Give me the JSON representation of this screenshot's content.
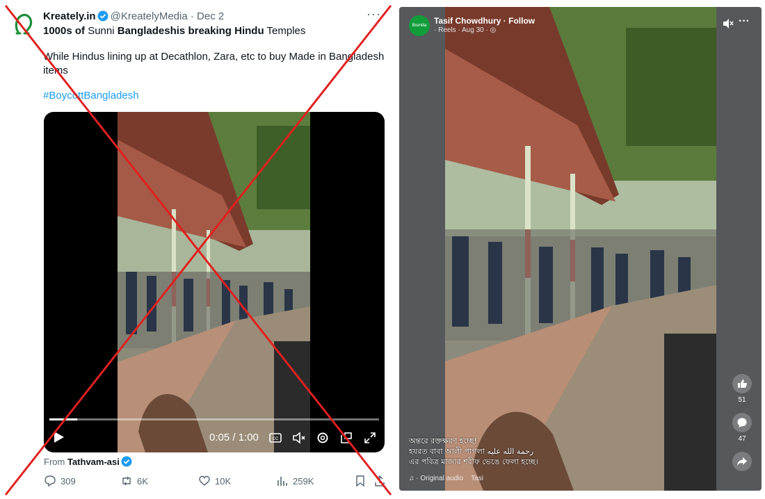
{
  "tweet": {
    "name": "Kreately.in",
    "handle": "@KreatelyMedia",
    "sep": "·",
    "date": "Dec 2",
    "more": "···",
    "title_parts": [
      {
        "text": "1000s of",
        "bold": true
      },
      {
        "text": " Sunni ",
        "bold": false
      },
      {
        "text": "Bangladeshis breaking Hindu",
        "bold": true
      },
      {
        "text": " Temples",
        "bold": false
      }
    ],
    "body": "While Hindus lining up at Decathlon, Zara, etc to buy Made in Bangladesh items",
    "hashtag": "#BoycottBangladesh",
    "video": {
      "time": "0:05 / 1:00",
      "progress": 0.085,
      "controls": [
        "play-icon",
        "captions-icon",
        "mute-icon",
        "settings-icon",
        "pip-icon",
        "fullscreen-icon"
      ]
    },
    "from_label": "From",
    "from_account": "Tathvam-asi",
    "actions": {
      "replies": "309",
      "reposts": "6K",
      "likes": "10K",
      "views": "259K"
    },
    "accent_color": "#1d9bf0",
    "verified_color": "#1d9bf0"
  },
  "reel": {
    "author": "Tasif Chowdhury · Follow",
    "meta": "· Reels · Aug 30 · ",
    "avatar_text": "Bismilla",
    "more": "···",
    "likes": "51",
    "comments": "47",
    "caption_lines": [
      "অন্তরে রক্তক্ষরণ হচ্ছে!",
      "হযরত বাবা আলী পাগলা رحمة الله عليه",
      "এর পবিত্র মাজার শরীফ ভেঙে ফেলা হচ্ছে।"
    ],
    "audio": "· Original audio",
    "audio_user": "Tasi"
  },
  "overlay": {
    "x_color": "#e02020"
  }
}
